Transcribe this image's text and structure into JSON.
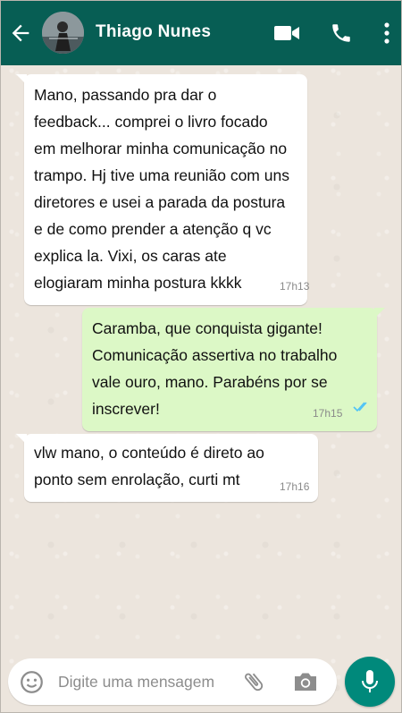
{
  "header": {
    "contact_name": "Thiago Nunes",
    "back_icon": "arrow-left-icon",
    "avatar": "contact-avatar",
    "actions": [
      "video-call-icon",
      "phone-icon",
      "more-vert-icon"
    ],
    "color": "#075e54"
  },
  "messages": [
    {
      "direction": "incoming",
      "text": "Mano, passando pra dar o\nfeedback...  comprei o livro focado\nem melhorar minha comunicação no\ntrampo. Hj tive uma reunião com uns\ndiretores  e usei a parada da postura\ne de como prender  a atenção q vc\nexplica la. Vixi,  os caras ate\nelogiaram  minha postura kkkk",
      "time": "17h13"
    },
    {
      "direction": "outgoing",
      "text": "Caramba, que conquista gigante!\nComunicação assertiva no trabalho\nvale ouro, mano. Parabéns por se\ninscrever!",
      "time": "17h15",
      "status_icon": "double-check-icon"
    },
    {
      "direction": "incoming",
      "text": "vlw mano, o conteúdo  é direto ao\nponto  sem enrolação,  curti mt",
      "time": "17h16"
    }
  ],
  "composer": {
    "placeholder": "Digite uma mensagem",
    "icons": [
      "emoji-icon",
      "attach-icon",
      "camera-icon",
      "mic-icon"
    ],
    "send_color": "#00897b"
  },
  "colors": {
    "incoming_bubble": "#ffffff",
    "outgoing_bubble": "#dcf8c6",
    "chat_background": "#ece5dd"
  }
}
